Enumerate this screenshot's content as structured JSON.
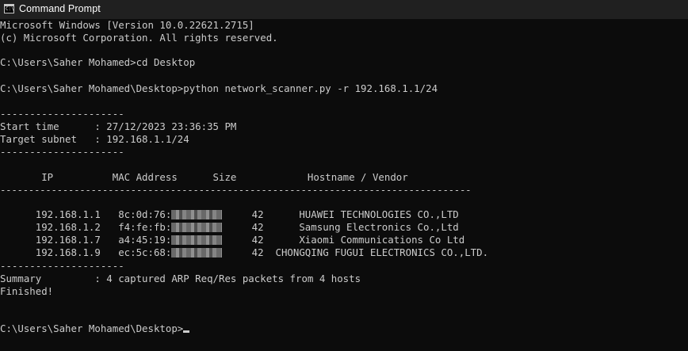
{
  "window": {
    "title": "Command Prompt",
    "icon": "cmd-icon"
  },
  "console": {
    "banner": [
      "Microsoft Windows [Version 10.0.22621.2715]",
      "(c) Microsoft Corporation. All rights reserved."
    ],
    "cmd1": "C:\\Users\\Saher Mohamed>cd Desktop",
    "cmd2": "C:\\Users\\Saher Mohamed\\Desktop>python network_scanner.py -r 192.168.1.1/24",
    "sep_short": "---------------------",
    "start_time": "Start time      : 27/12/2023 23:36:35 PM",
    "target_subnet": "Target subnet   : 192.168.1.1/24",
    "table_header": "       IP          MAC Address      Size            Hostname / Vendor",
    "sep_long": "-----------------------------------------------------------------------------------",
    "rows": [
      {
        "ip": "  192.168.1.1",
        "mac": "8c:0d:76:",
        "size": "42",
        "vendor": "      HUAWEI TECHNOLOGIES CO.,LTD"
      },
      {
        "ip": "  192.168.1.2",
        "mac": "f4:fe:fb:",
        "size": "42",
        "vendor": "      Samsung Electronics Co.,Ltd"
      },
      {
        "ip": "  192.168.1.7",
        "mac": "a4:45:19:",
        "size": "42",
        "vendor": "      Xiaomi Communications Co Ltd"
      },
      {
        "ip": "  192.168.1.9",
        "mac": "ec:5c:68:",
        "size": "42",
        "vendor": "  CHONGQING FUGUI ELECTRONICS CO.,LTD."
      }
    ],
    "summary": "Summary         : 4 captured ARP Req/Res packets from 4 hosts",
    "finished": "Finished!",
    "prompt": "C:\\Users\\Saher Mohamed\\Desktop>"
  }
}
